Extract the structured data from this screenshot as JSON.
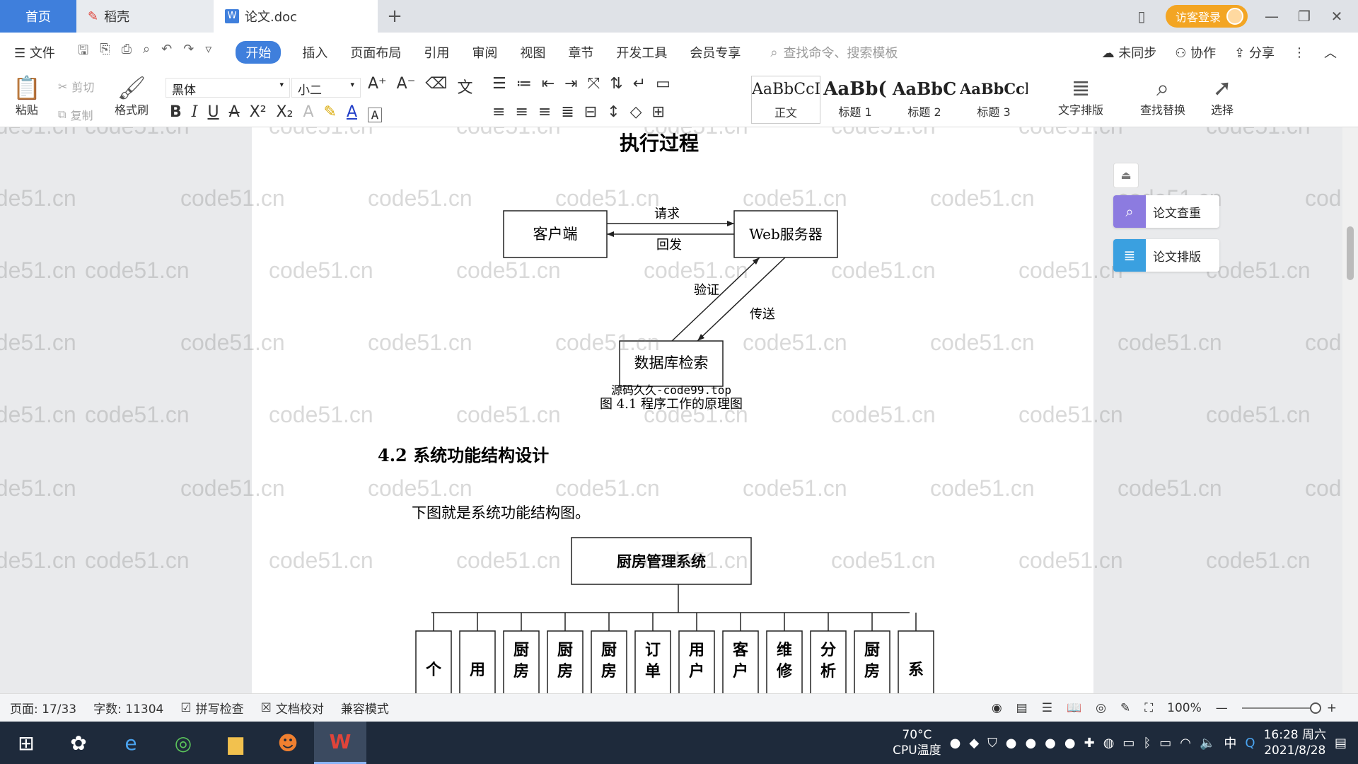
{
  "titlebar": {
    "tabs": [
      {
        "label": "首页"
      },
      {
        "label": "稻壳"
      },
      {
        "label": "论文.doc"
      }
    ],
    "add": "+",
    "visitor_login": "访客登录"
  },
  "menu": {
    "file": "文件",
    "items": [
      "开始",
      "插入",
      "页面布局",
      "引用",
      "审阅",
      "视图",
      "章节",
      "开发工具",
      "会员专享"
    ],
    "search_placeholder": "查找命令、搜索模板",
    "unsynced": "未同步",
    "collab": "协作",
    "share": "分享"
  },
  "ribbon": {
    "paste": "粘贴",
    "cut": "剪切",
    "copy": "复制",
    "format_painter": "格式刷",
    "font": "黑体",
    "size": "小二",
    "styles": [
      {
        "preview": "AaBbCcI",
        "label": "正文"
      },
      {
        "preview": "AaBb(",
        "label": "标题 1"
      },
      {
        "preview": "AaBbC",
        "label": "标题 2"
      },
      {
        "preview": "AaBbCcl",
        "label": "标题 3"
      }
    ],
    "text_layout": "文字排版",
    "find_replace": "查找替换",
    "select": "选择"
  },
  "document": {
    "heading_top": "执行过程",
    "fig1": {
      "client": "客户端",
      "server": "Web服务器",
      "request": "请求",
      "reply": "回发",
      "verify": "验证",
      "transfer": "传送",
      "db": "数据库检索",
      "source": "源码久久-code99.top",
      "caption": "图 4.1  程序工作的原理图"
    },
    "section_title": "4.2 系统功能结构设计",
    "paragraph": "下图就是系统功能结构图。",
    "fig2": {
      "root": "厨房管理系统",
      "children": [
        "个",
        "用",
        "厨房",
        "厨房",
        "厨房",
        "订单",
        "用户",
        "客户",
        "维修",
        "分析",
        "厨房",
        "系"
      ]
    },
    "watermark": "code51.cn"
  },
  "side_panel": {
    "check": "论文查重",
    "layout": "论文排版"
  },
  "status": {
    "page": "页面: 17/33",
    "words": "字数: 11304",
    "spell": "拼写检查",
    "proof": "文档校对",
    "compat": "兼容模式",
    "zoom": "100%"
  },
  "taskbar": {
    "temp": "70°C",
    "cpu": "CPU温度",
    "ime": "中",
    "time": "16:28 周六",
    "date": "2021/8/28"
  }
}
